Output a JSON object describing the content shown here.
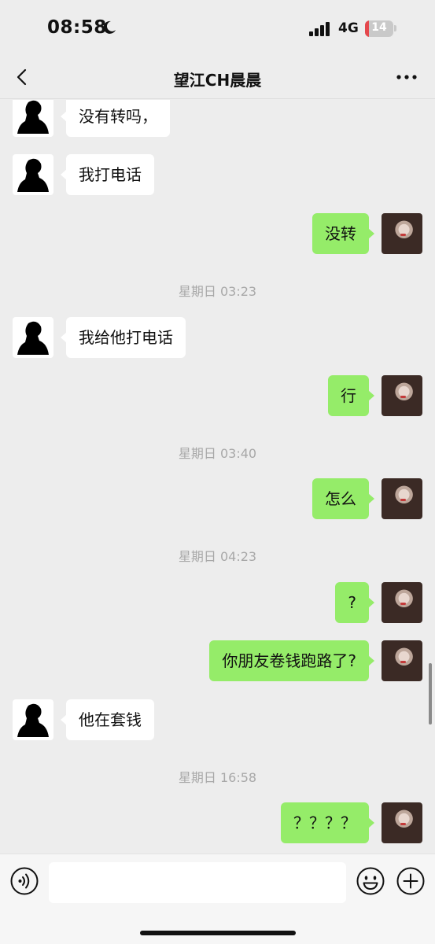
{
  "status": {
    "time": "08:58",
    "network": "4G",
    "battery": "14",
    "battery_fraction": 0.14
  },
  "header": {
    "title": "望江CH晨晨"
  },
  "messages": [
    {
      "side": "in",
      "text": "没有转吗，"
    },
    {
      "side": "in",
      "text": "我打电话"
    },
    {
      "side": "out",
      "text": "没转"
    },
    {
      "timestamp": "星期日 03:23"
    },
    {
      "side": "in",
      "text": "我给他打电话"
    },
    {
      "side": "out",
      "text": "行"
    },
    {
      "timestamp": "星期日 03:40"
    },
    {
      "side": "out",
      "text": "怎么"
    },
    {
      "timestamp": "星期日 04:23"
    },
    {
      "side": "out",
      "text": "?"
    },
    {
      "side": "out",
      "text": "你朋友卷钱跑路了?"
    },
    {
      "side": "in",
      "text": "他在套钱"
    },
    {
      "timestamp": "星期日 16:58"
    },
    {
      "side": "out",
      "text": "？？？？"
    }
  ],
  "input": {
    "value": ""
  },
  "icons": {
    "back": "chevron-left-icon",
    "more": "more-icon",
    "voice": "voice-icon",
    "emoji": "emoji-icon",
    "plus": "plus-icon"
  },
  "colors": {
    "background": "#ededed",
    "outgoing_bubble": "#95ec69",
    "incoming_bubble": "#ffffff"
  }
}
